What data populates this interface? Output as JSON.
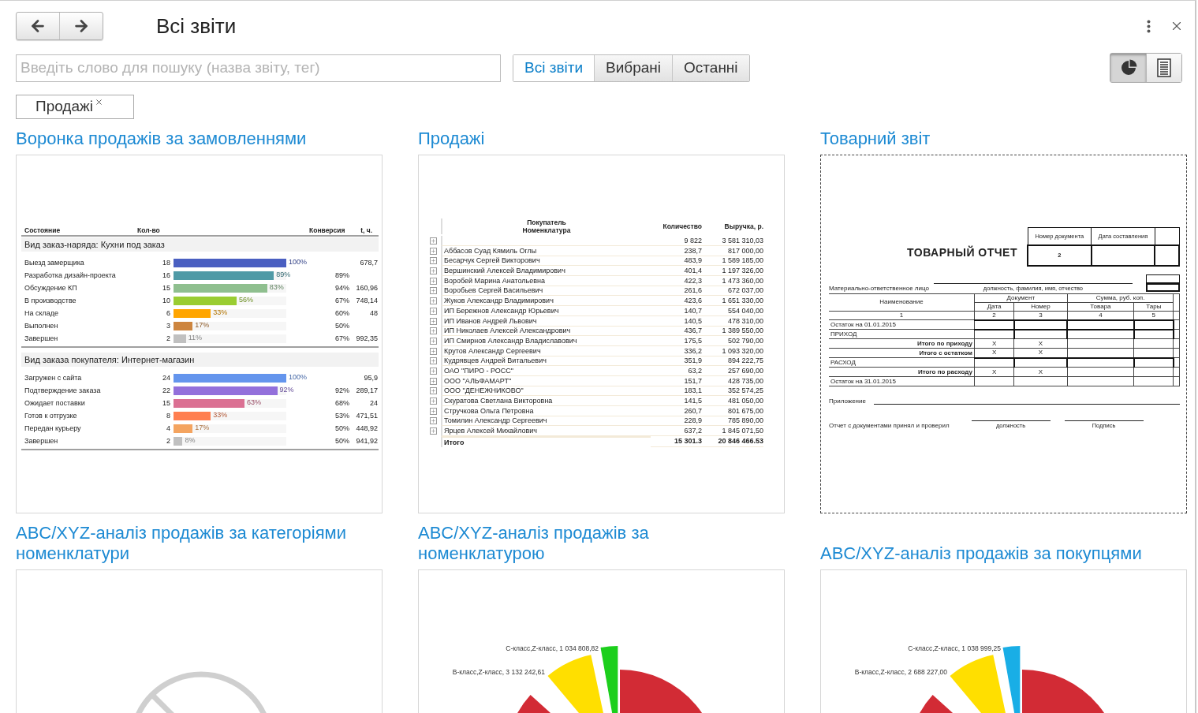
{
  "title": "Всі звіти",
  "search": {
    "placeholder": "Введіть слово для пошуку (назва звіту, тег)"
  },
  "tabs": [
    {
      "label": "Всі звіти",
      "selected": true
    },
    {
      "label": "Вибрані",
      "selected": false
    },
    {
      "label": "Останні",
      "selected": false
    }
  ],
  "view_modes": [
    {
      "kind": "chart",
      "selected": true
    },
    {
      "kind": "list",
      "selected": false
    }
  ],
  "filter_tags": [
    {
      "label": "Продажі"
    }
  ],
  "reports": [
    {
      "title": "Воронка продажів за замовленнями",
      "kind": "funnel",
      "selected": false,
      "columns": [
        "Состояние",
        "Кол-во",
        "Конверсия",
        "t, ч."
      ],
      "groups": [
        {
          "title": "Вид заказ-наряда: Кухни под заказ",
          "rows": [
            {
              "name": "Выезд замерщика",
              "count": "18",
              "level": 1,
              "percent": "100%",
              "time": "678,7",
              "color": "#4a5fc1"
            },
            {
              "name": "Разработка дизайн-проекта",
              "count": "16",
              "level": 0.89,
              "percent": "89%",
              "conversion": "89%",
              "color": "#4f9aa6"
            },
            {
              "name": "Обсуждение КП",
              "count": "15",
              "level": 0.83,
              "percent": "83%",
              "conversion": "94%",
              "time": "160,96",
              "color": "#8fbf8f"
            },
            {
              "name": "В производстве",
              "count": "10",
              "level": 0.56,
              "percent": "56%",
              "conversion": "67%",
              "time": "748,14",
              "color": "#9acd32"
            },
            {
              "name": "На складе",
              "count": "6",
              "level": 0.33,
              "percent": "33%",
              "conversion": "60%",
              "time": "48",
              "color": "#ffa500"
            },
            {
              "name": "Выполнен",
              "count": "3",
              "level": 0.17,
              "percent": "17%",
              "conversion": "50%",
              "color": "#cd853f"
            },
            {
              "name": "Завершен",
              "count": "2",
              "level": 0.11,
              "percent": "11%",
              "conversion": "67%",
              "time": "992,35",
              "color": "#c0c0c0"
            }
          ]
        },
        {
          "title": "Вид заказа покупателя: Интернет-магазин",
          "rows": [
            {
              "name": "Загружен с сайта",
              "count": "24",
              "level": 1,
              "percent": "100%",
              "time": "95,9",
              "color": "#6495ed"
            },
            {
              "name": "Подтверждение заказа",
              "count": "22",
              "level": 0.92,
              "percent": "92%",
              "conversion": "92%",
              "time": "289,17",
              "color": "#9370db"
            },
            {
              "name": "Ожидает поставки",
              "count": "15",
              "level": 0.63,
              "percent": "63%",
              "conversion": "68%",
              "time": "24",
              "color": "#db7093"
            },
            {
              "name": "Готов к отгрузке",
              "count": "8",
              "level": 0.33,
              "percent": "33%",
              "conversion": "53%",
              "time": "471,51",
              "color": "#ff7f50"
            },
            {
              "name": "Передан курьеру",
              "count": "4",
              "level": 0.17,
              "percent": "17%",
              "conversion": "50%",
              "time": "448,92",
              "color": "#f4a460"
            },
            {
              "name": "Завершен",
              "count": "2",
              "level": 0.08,
              "percent": "8%",
              "conversion": "50%",
              "time": "941,92",
              "color": "#c0c0c0"
            }
          ]
        }
      ]
    },
    {
      "title": "Продажі",
      "kind": "table",
      "selected": false,
      "columns": [
        "Покупатель",
        "Номенклатура",
        "Количество",
        "Выручка, р."
      ],
      "rows": [
        {
          "qty": "9 822",
          "revenue": "3 581 310,03"
        },
        {
          "name": "Аббасов Суад Кямиль Оглы",
          "qty": "238,7",
          "revenue": "817 000,00"
        },
        {
          "name": "Бесарчук Сергей Викторович",
          "qty": "483,9",
          "revenue": "1 589 185,00"
        },
        {
          "name": "Вершинский Алексей Владимирович",
          "qty": "401,4",
          "revenue": "1 197 326,00"
        },
        {
          "name": "Воробей Марина Анатольевна",
          "qty": "422,3",
          "revenue": "1 473 360,00"
        },
        {
          "name": "Воробьев Сергей Васильевич",
          "qty": "261,6",
          "revenue": "672 037,00"
        },
        {
          "name": "Жуков Александр Владимирович",
          "qty": "423,6",
          "revenue": "1 651 330,00"
        },
        {
          "name": "ИП Бережнов Александр Юрьевич",
          "qty": "140,7",
          "revenue": "554 040,00"
        },
        {
          "name": "ИП Иванов Андрей Львович",
          "qty": "140,5",
          "revenue": "478 310,00"
        },
        {
          "name": "ИП Николаев Алексей Александрович",
          "qty": "436,7",
          "revenue": "1 389 550,00"
        },
        {
          "name": "ИП Смирнов Александр Владиславович",
          "qty": "175,5",
          "revenue": "502 790,00"
        },
        {
          "name": "Крутов Александр Сергеевич",
          "qty": "336,2",
          "revenue": "1 093 320,00"
        },
        {
          "name": "Кудрявцев Андрей Витальевич",
          "qty": "351,9",
          "revenue": "894 222,75"
        },
        {
          "name": "ОАО \"ПИРО - РОСС\"",
          "qty": "63,2",
          "revenue": "257 690,00"
        },
        {
          "name": "ООО \"АЛЬФАМАРТ\"",
          "qty": "151,7",
          "revenue": "428 735,00"
        },
        {
          "name": "ООО \"ДЕНЕЖНИКОВО\"",
          "qty": "183,1",
          "revenue": "352 574,25"
        },
        {
          "name": "Скуратова Светлана Викторовна",
          "qty": "141,5",
          "revenue": "481 050,00"
        },
        {
          "name": "Стручкова Ольга Петровна",
          "qty": "260,7",
          "revenue": "801 675,00"
        },
        {
          "name": "Томилин Александр Сергеевич",
          "qty": "228,9",
          "revenue": "785 890,00"
        },
        {
          "name": "Ярцев Алексей Михайлович",
          "qty": "637,2",
          "revenue": "1 845 071,50"
        }
      ],
      "total": {
        "label": "Итого",
        "qty": "15 301.3",
        "revenue": "20 846 466.53"
      }
    },
    {
      "title": "Товарний звіт",
      "kind": "form",
      "selected": true,
      "form": {
        "heading": "ТОВАРНЫЙ ОТЧЕТ",
        "doc_columns": [
          "Номер документа",
          "Дата составления"
        ],
        "doc_number": "2",
        "person_label": "Материально-ответственное лицо",
        "person_caption": "должность, фамилия, имя, отчество",
        "name_header": "Наименование",
        "group_headers": [
          "Документ",
          "Сумма, руб. коп."
        ],
        "sub_headers": [
          "Дата",
          "Номер",
          "Товара",
          "Тары"
        ],
        "numbers": [
          "1",
          "2",
          "3",
          "4",
          "5"
        ],
        "rows": [
          {
            "kind": "entry",
            "label": "Остаток на 01.01.2015"
          },
          {
            "kind": "entry",
            "label": "ПРИХОД"
          },
          {
            "kind": "total",
            "label": "Итого по приходу",
            "marks": [
              "X",
              "X"
            ]
          },
          {
            "kind": "total",
            "label": "Итого с остатком",
            "marks": [
              "X",
              "X"
            ]
          },
          {
            "kind": "entry",
            "label": "РАСХОД"
          },
          {
            "kind": "total",
            "label": "Итого по расходу",
            "marks": [
              "X",
              "X"
            ]
          },
          {
            "kind": "balance",
            "label": "Остаток на 31.01.2015"
          }
        ],
        "appendix_label": "Приложение",
        "check_label": "Отчет с документами принял и проверил",
        "sign_captions": [
          "должность",
          "Подпись"
        ]
      }
    },
    {
      "title": "ABC/XYZ-аналіз продажів за категоріями номенклатури",
      "kind": "empty",
      "selected": false
    },
    {
      "title": "ABC/XYZ-аналіз продажів за номенклатурою",
      "kind": "pie",
      "selected": false,
      "slices": [
        {
          "color": "#d22b35"
        },
        {
          "color": "#d22b35"
        },
        {
          "color": "#1ccf1c",
          "label": "C-класс,Z-класс, 1 034 808,82"
        },
        {
          "color": "#ffdf00",
          "label": "B-класс,Z-класс, 3 132 242,61"
        }
      ]
    },
    {
      "title": "ABC/XYZ-аналіз продажів за покупцями",
      "kind": "pie",
      "selected": false,
      "slices": [
        {
          "color": "#d22b35"
        },
        {
          "color": "#d22b35"
        },
        {
          "color": "#19aee6",
          "label": "C-класс,Z-класс, 1 038 999,25"
        },
        {
          "color": "#ffdf00",
          "label": "B-класс,Z-класс, 2 688 227,00"
        }
      ]
    }
  ]
}
